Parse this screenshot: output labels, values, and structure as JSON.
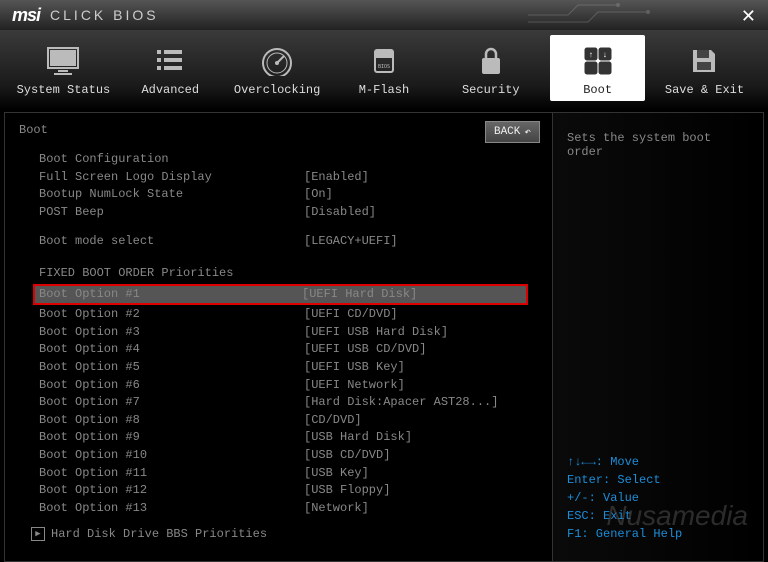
{
  "header": {
    "brand": "msi",
    "product": "CLICK BIOS"
  },
  "nav": {
    "items": [
      {
        "label": "System Status"
      },
      {
        "label": "Advanced"
      },
      {
        "label": "Overclocking"
      },
      {
        "label": "M-Flash"
      },
      {
        "label": "Security"
      },
      {
        "label": "Boot"
      },
      {
        "label": "Save & Exit"
      }
    ]
  },
  "back_label": "BACK",
  "page_title": "Boot",
  "groups": {
    "boot_config_header": "Boot Configuration",
    "full_screen_logo": {
      "label": "Full Screen Logo Display",
      "value": "[Enabled]"
    },
    "numlock": {
      "label": "Bootup NumLock State",
      "value": "[On]"
    },
    "post_beep": {
      "label": "POST Beep",
      "value": "[Disabled]"
    },
    "boot_mode": {
      "label": "Boot mode select",
      "value": "[LEGACY+UEFI]"
    },
    "fixed_header": "FIXED BOOT ORDER Priorities"
  },
  "boot_options": [
    {
      "label": "Boot Option #1",
      "value": "[UEFI Hard Disk]",
      "highlighted": true
    },
    {
      "label": "Boot Option #2",
      "value": "[UEFI CD/DVD]"
    },
    {
      "label": "Boot Option #3",
      "value": "[UEFI USB Hard Disk]"
    },
    {
      "label": "Boot Option #4",
      "value": "[UEFI USB CD/DVD]"
    },
    {
      "label": "Boot Option #5",
      "value": "[UEFI USB Key]"
    },
    {
      "label": "Boot Option #6",
      "value": "[UEFI Network]"
    },
    {
      "label": "Boot Option #7",
      "value": "[Hard Disk:Apacer AST28...]"
    },
    {
      "label": "Boot Option #8",
      "value": "[CD/DVD]"
    },
    {
      "label": "Boot Option #9",
      "value": "[USB Hard Disk]"
    },
    {
      "label": "Boot Option #10",
      "value": "[USB CD/DVD]"
    },
    {
      "label": "Boot Option #11",
      "value": "[USB Key]"
    },
    {
      "label": "Boot Option #12",
      "value": "[USB Floppy]"
    },
    {
      "label": "Boot Option #13",
      "value": "[Network]"
    }
  ],
  "bbs_label": "Hard Disk Drive BBS Priorities",
  "side": {
    "description": "Sets the system boot order",
    "hotkeys": {
      "move": "↑↓←→: Move",
      "select": "Enter: Select",
      "value": "+/-: Value",
      "exit": "ESC: Exit",
      "help": "F1: General Help"
    }
  },
  "watermark": "Nusamedia"
}
